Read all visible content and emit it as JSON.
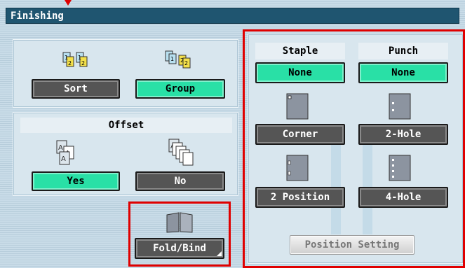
{
  "window": {
    "title": "Finishing"
  },
  "sort_group": {
    "sort_label": "Sort",
    "group_label": "Group",
    "selected": "Group"
  },
  "offset": {
    "header": "Offset",
    "yes_label": "Yes",
    "no_label": "No",
    "selected": "Yes"
  },
  "fold_bind": {
    "label": "Fold/Bind"
  },
  "staple": {
    "header": "Staple",
    "none_label": "None",
    "corner_label": "Corner",
    "two_position_label": "2 Position",
    "selected": "None"
  },
  "punch": {
    "header": "Punch",
    "none_label": "None",
    "two_hole_label": "2-Hole",
    "four_hole_label": "4-Hole",
    "selected": "None"
  },
  "position_setting": {
    "label": "Position Setting",
    "enabled": false
  },
  "colors": {
    "title_bar": "#1f5570",
    "selected": "#29e0a6",
    "unselected": "#555555",
    "highlight": "#e00000"
  },
  "icons": [
    "sort-icon",
    "group-icon",
    "offset-yes-icon",
    "offset-no-icon",
    "fold-bind-icon",
    "staple-corner-icon",
    "staple-two-position-icon",
    "punch-two-hole-icon",
    "punch-four-hole-icon"
  ]
}
